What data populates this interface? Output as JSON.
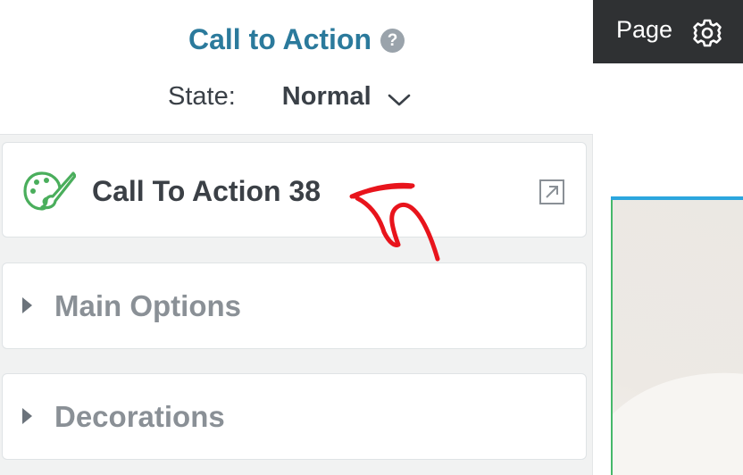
{
  "panel": {
    "title": "Call to Action",
    "help_icon": "?",
    "state_label": "State:",
    "state_value": "Normal"
  },
  "block": {
    "label": "Call To Action 38",
    "icon": "palette-icon",
    "open_icon": "external-link-icon"
  },
  "sections": [
    {
      "label": "Main Options"
    },
    {
      "label": "Decorations"
    }
  ],
  "topbar": {
    "page_label": "Page",
    "icon": "gear-icon"
  },
  "colors": {
    "title": "#2b7a9c",
    "icon_green": "#4aae5c",
    "annotation_red": "#e8141c",
    "topbar_bg": "#2f3133",
    "selection_blue": "#2ba6de"
  }
}
